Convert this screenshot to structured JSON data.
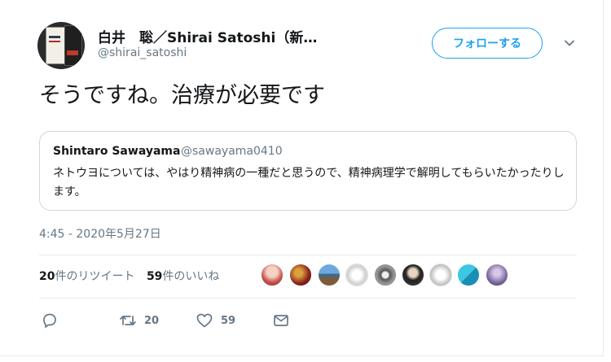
{
  "tweet": {
    "author_name": "白井　聡／Shirai Satoshi（新…",
    "author_handle": "@shirai_satoshi",
    "follow_label": "フォローする",
    "text": "そうですね。治療が必要です",
    "timestamp": "4:45 - 2020年5月27日"
  },
  "quoted": {
    "name": "Shintaro Sawayama",
    "handle": "@sawayama0410",
    "text": "ネトウヨについては、やはり精神病の一種だと思うので、精神病理学で解明してもらいたかったりします。"
  },
  "stats": {
    "retweets_count": "20",
    "retweets_label": "件のリツイート",
    "likes_count": "59",
    "likes_label": "件のいいね"
  },
  "actions": {
    "retweet_count": "20",
    "like_count": "59"
  },
  "icons": {
    "reply": "reply-icon",
    "retweet": "retweet-icon",
    "like": "heart-icon",
    "dm": "envelope-icon",
    "caret": "chevron-down-icon"
  },
  "colors": {
    "accent": "#1da1f2",
    "secondary_text": "#657786"
  }
}
